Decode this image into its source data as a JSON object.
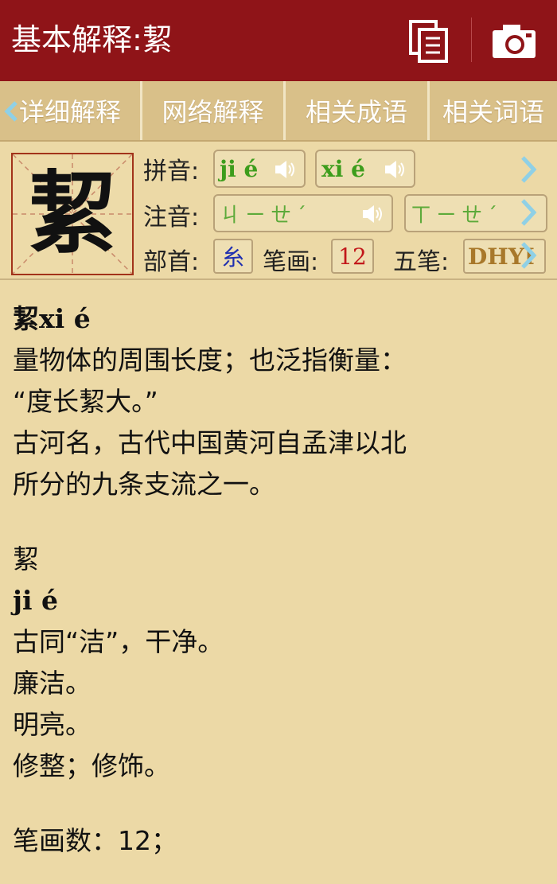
{
  "header": {
    "title": "基本解释:絜"
  },
  "tabs": [
    {
      "label": "详细解释"
    },
    {
      "label": "网络解释"
    },
    {
      "label": "相关成语"
    },
    {
      "label": "相关词语"
    }
  ],
  "character": "絜",
  "pinyin": {
    "label": "拼音:",
    "readings": [
      "ji é",
      "xi é"
    ]
  },
  "zhuyin": {
    "label": "注音:",
    "readings": [
      "ㄐㄧㄝˊ",
      "ㄒㄧㄝˊ"
    ]
  },
  "info": {
    "radical_label": "部首:",
    "radical": "糸",
    "strokes_label": "笔画:",
    "strokes": "12",
    "wubi_label": "五笔:",
    "wubi": "DHYI"
  },
  "colors": {
    "header_bg": "#8f1418",
    "page_bg": "#ecd9a6",
    "pinyin": "#3d9d1c",
    "radical": "#1f2fb0",
    "strokes": "#c2181b",
    "wubi": "#a8782a",
    "arrow": "#8fd0e6"
  },
  "definition": {
    "lines": [
      {
        "text": "絜xi é",
        "type": "py"
      },
      {
        "text": "量物体的周围长度；也泛指衡量：",
        "type": "normal"
      },
      {
        "text": "“度长絜大。”",
        "type": "normal"
      },
      {
        "text": "古河名，古代中国黄河自孟津以北",
        "type": "normal"
      },
      {
        "text": "所分的九条支流之一。",
        "type": "normal"
      },
      {
        "text": "",
        "type": "blank"
      },
      {
        "text": "絜",
        "type": "normal"
      },
      {
        "text": "ji é",
        "type": "py"
      },
      {
        "text": "古同“洁”，干净。",
        "type": "normal"
      },
      {
        "text": "廉洁。",
        "type": "normal"
      },
      {
        "text": "明亮。",
        "type": "normal"
      },
      {
        "text": "修整；修饰。",
        "type": "normal"
      },
      {
        "text": "",
        "type": "blank"
      },
      {
        "text": "笔画数：12；",
        "type": "normal"
      }
    ]
  }
}
